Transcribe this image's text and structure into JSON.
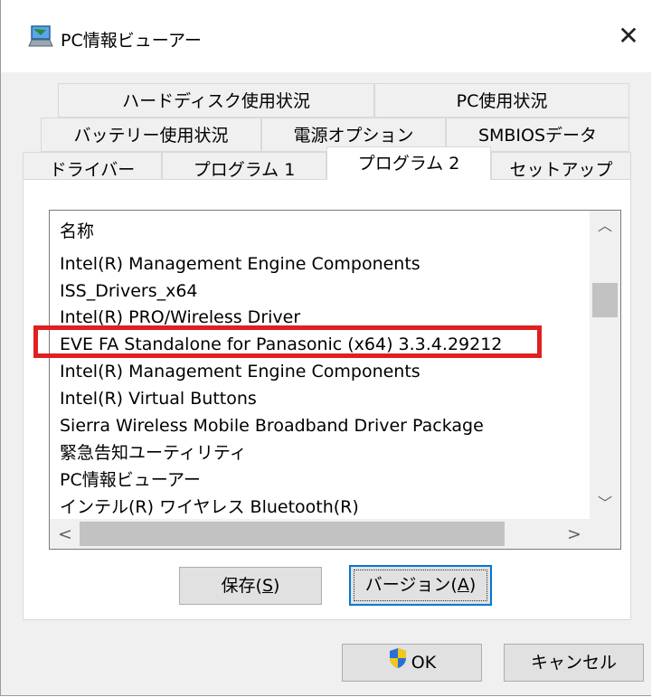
{
  "window": {
    "title": "PC情報ビューアー",
    "close_glyph": "✕"
  },
  "tabs": {
    "row1": [
      "ハードディスク使用状況",
      "PC使用状況"
    ],
    "row2": [
      "バッテリー使用状況",
      "電源オプション",
      "SMBIOSデータ"
    ],
    "row3": [
      "ドライバー",
      "プログラム 1",
      "プログラム 2",
      "セットアップ"
    ],
    "active": "プログラム 2"
  },
  "list": {
    "items": [
      "名称",
      "Intel(R) Management Engine Components",
      "ISS_Drivers_x64",
      "Intel(R) PRO/Wireless Driver",
      "EVE FA Standalone for Panasonic (x64) 3.3.4.29212",
      "Intel(R) Management Engine Components",
      "Intel(R) Virtual Buttons",
      "Sierra Wireless Mobile Broadband Driver Package",
      "緊急告知ユーティリティ",
      "PC情報ビューアー",
      "インテル(R) ワイヤレス Bluetooth(R)"
    ],
    "highlighted_item": "EVE FA Standalone for Panasonic (x64) 3.3.4.29212",
    "highlight_color": "#e02020"
  },
  "scrollbar": {
    "up": "︿",
    "down": "﹀",
    "left": "<",
    "right": ">"
  },
  "buttons": {
    "save": {
      "label": "保存(",
      "key": "S",
      "suffix": ")"
    },
    "version": {
      "label": "バージョン(",
      "key": "A",
      "suffix": ")"
    },
    "ok": "OK",
    "cancel": "キャンセル"
  },
  "icons": {
    "app": "laptop-icon",
    "ok": "uac-shield-icon"
  },
  "colors": {
    "focus": "#0078d7",
    "accent_shield_blue": "#2a6fd6",
    "accent_shield_yellow": "#f5c518"
  }
}
